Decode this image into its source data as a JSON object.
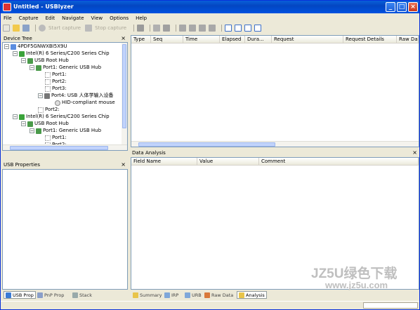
{
  "window": {
    "title": "Untitled - USBlyzer",
    "btn_min": "_",
    "btn_max": "□",
    "btn_close": "×"
  },
  "menu": [
    "File",
    "Capture",
    "Edit",
    "Navigate",
    "View",
    "Options",
    "Help"
  ],
  "toolbar": {
    "start_capture": "Start capture",
    "stop_capture": "Stop capture"
  },
  "device_tree": {
    "title": "Device Tree",
    "close": "×",
    "nodes": [
      {
        "label": "4PDF5GNWXBI5X9U"
      },
      {
        "label": "Intel(R) 6 Series/C200 Series Chip"
      },
      {
        "label": "USB Root Hub"
      },
      {
        "label": "Port1: Generic USB Hub"
      },
      {
        "label": "Port1:"
      },
      {
        "label": "Port2:"
      },
      {
        "label": "Port3:"
      },
      {
        "label": "Port4: USB 人体学输入设备"
      },
      {
        "label": "HID-compliant mouse"
      },
      {
        "label": "Port2:"
      },
      {
        "label": "Intel(R) 6 Series/C200 Series Chip"
      },
      {
        "label": "USB Root Hub"
      },
      {
        "label": "Port1: Generic USB Hub"
      },
      {
        "label": "Port1:"
      },
      {
        "label": "Port2:"
      }
    ]
  },
  "usb_properties": {
    "title": "USB Properties",
    "close": "×"
  },
  "left_tabs": [
    "USB Prop",
    "PnP Prop",
    "Stack"
  ],
  "capture_list": {
    "columns": [
      "Type",
      "Seq",
      "Time",
      "Elapsed",
      "Dura...",
      "Request",
      "Request Details",
      "Raw Dat"
    ]
  },
  "data_analysis": {
    "title": "Data Analysis",
    "close": "×",
    "columns": [
      "Field Name",
      "Value",
      "Comment"
    ]
  },
  "right_tabs": [
    "Summary",
    "IRP",
    "URB",
    "Raw Data",
    "Analysis"
  ],
  "watermark": {
    "line1": "JZ5U绿色下载",
    "line2": "www.jz5u.com"
  },
  "colors": {
    "titlebar": "#0346c2",
    "pane_border": "#7f9db9",
    "window_bg": "#ece9d8"
  }
}
